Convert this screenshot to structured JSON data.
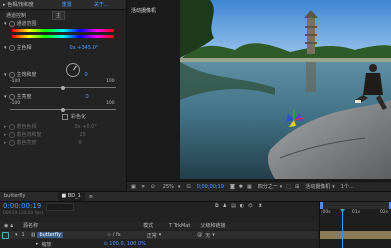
{
  "effects_panel": {
    "tab_left": "▸ 色相/饱和度",
    "tab_mid": "重置",
    "tab_right": "关于...",
    "channel_control_label": "通道控制",
    "channel_control_value": "主",
    "channel_range_label": "通道范围",
    "hue_label": "主色相",
    "hue_value": "0x +345.0°",
    "saturation_label": "主饱和度",
    "saturation_value": "0",
    "saturation_min": "-100",
    "saturation_max": "100",
    "lightness_label": "主亮度",
    "lightness_value": "0",
    "lightness_min": "-100",
    "lightness_max": "100",
    "colorize_label": "彩色化",
    "colorize_hue_label": "着色色相",
    "colorize_sat_label": "着色饱和度",
    "colorize_light_label": "着色亮度",
    "colorize_hue_value": "0x +0.0°",
    "colorize_sat_value": "25",
    "colorize_light_value": "0"
  },
  "viewer": {
    "camera_label": "活动摄像机",
    "zoom": "25%",
    "timecode": "0;00;00;19",
    "quality": "四分之一",
    "view_select": "活动摄像机",
    "view_count": "1个..."
  },
  "timeline": {
    "tab_project": "butterfly",
    "tab_comp": "■ BD_1",
    "timecode": "0:00:00:19",
    "frame_info": "00019 (24.00 fps)",
    "col_source": "源名称",
    "col_mode": "模式",
    "col_trkmat": "T TrkMat",
    "col_parent": "父级和链接",
    "layer_index": "1",
    "layer_name": "butterfly",
    "layer_mode": "正常",
    "layer_parent": "无",
    "sub_row_label": "缩放",
    "sub_row_value": "⊙ 100.0, 100.0%",
    "ruler_start": ":00s",
    "ruler_mid": "01s",
    "ruler_end": "02s"
  }
}
